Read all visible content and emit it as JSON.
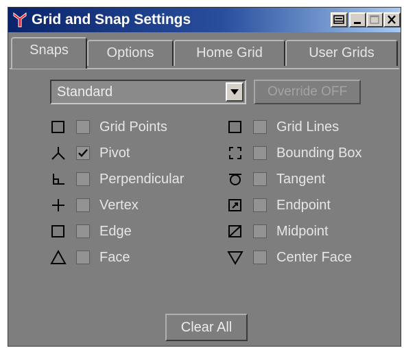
{
  "window": {
    "title": "Grid and Snap Settings",
    "icons": {
      "app": "tripod-icon",
      "pin": "pin-icon",
      "minimize": "minimize-icon",
      "maximize": "maximize-icon",
      "close": "close-icon"
    }
  },
  "tabs": [
    {
      "label": "Snaps",
      "active": true
    },
    {
      "label": "Options",
      "active": false
    },
    {
      "label": "Home Grid",
      "active": false
    },
    {
      "label": "User Grids",
      "active": false
    }
  ],
  "snap_set": {
    "selected": "Standard",
    "override_label": "Override OFF",
    "override_enabled": false
  },
  "snaps": {
    "left": [
      {
        "label": "Grid Points",
        "checked": false,
        "icon": "grid-points-icon"
      },
      {
        "label": "Pivot",
        "checked": true,
        "icon": "pivot-icon"
      },
      {
        "label": "Perpendicular",
        "checked": false,
        "icon": "perpendicular-icon"
      },
      {
        "label": "Vertex",
        "checked": false,
        "icon": "vertex-icon"
      },
      {
        "label": "Edge",
        "checked": false,
        "icon": "edge-icon"
      },
      {
        "label": "Face",
        "checked": false,
        "icon": "face-icon"
      }
    ],
    "right": [
      {
        "label": "Grid Lines",
        "checked": false,
        "icon": "grid-lines-icon"
      },
      {
        "label": "Bounding Box",
        "checked": false,
        "icon": "bounding-box-icon"
      },
      {
        "label": "Tangent",
        "checked": false,
        "icon": "tangent-icon"
      },
      {
        "label": "Endpoint",
        "checked": false,
        "icon": "endpoint-icon"
      },
      {
        "label": "Midpoint",
        "checked": false,
        "icon": "midpoint-icon"
      },
      {
        "label": "Center Face",
        "checked": false,
        "icon": "center-face-icon"
      }
    ]
  },
  "actions": {
    "clear_all": "Clear All"
  },
  "colors": {
    "panel": "#7e7e7e",
    "title_gradient_start": "#0a246a",
    "title_gradient_end": "#a6caf0",
    "text": "#e6e6e6",
    "disabled_text": "#a4a4a4"
  }
}
